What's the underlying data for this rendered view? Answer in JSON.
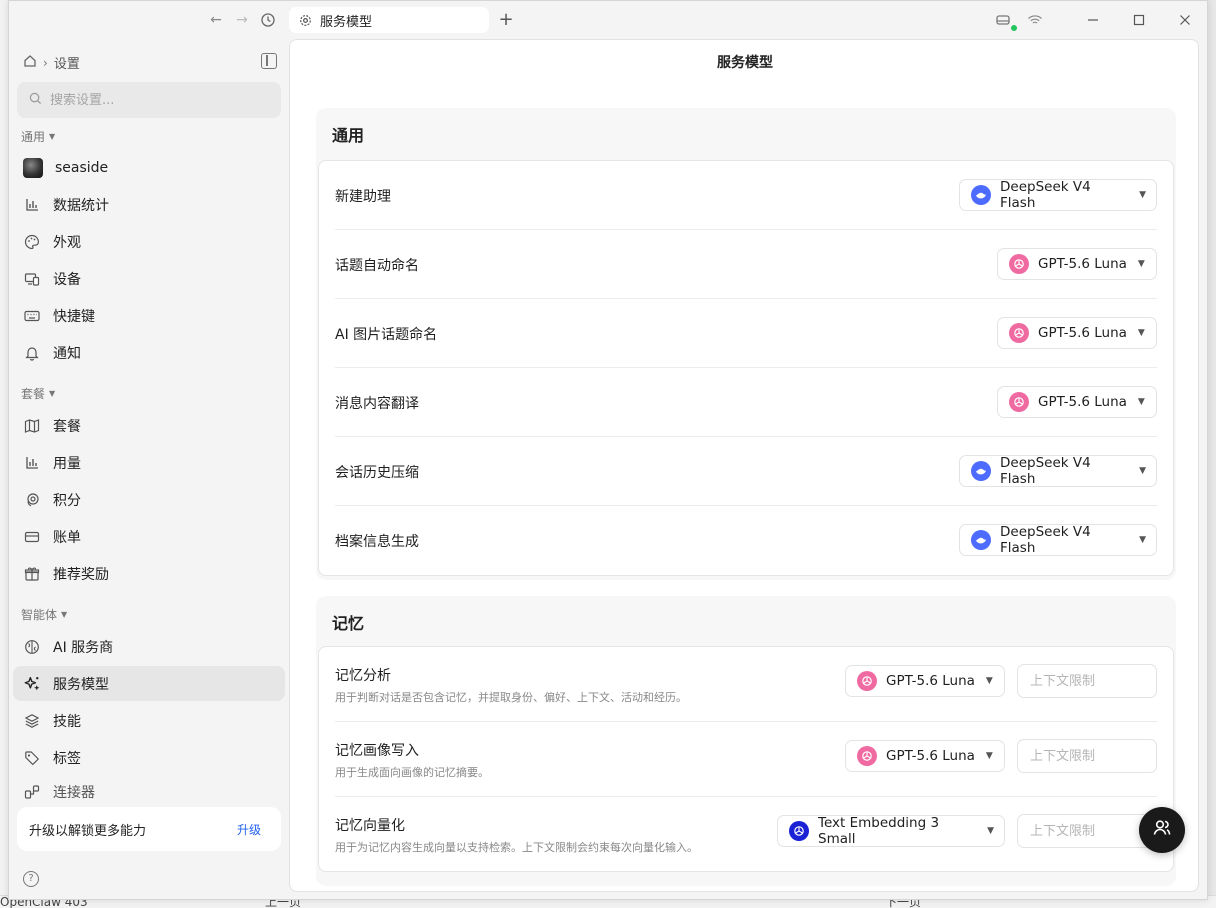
{
  "tab": {
    "title": "服务模型"
  },
  "breadcrumb": {
    "current": "设置"
  },
  "search": {
    "placeholder": "搜索设置..."
  },
  "sidebar": {
    "groups": [
      {
        "label": "通用"
      },
      {
        "label": "套餐"
      },
      {
        "label": "智能体"
      }
    ],
    "items": [
      {
        "label": "seaside",
        "icon": "avatar"
      },
      {
        "label": "数据统计",
        "icon": "bar-chart-icon"
      },
      {
        "label": "外观",
        "icon": "palette-icon"
      },
      {
        "label": "设备",
        "icon": "devices-icon"
      },
      {
        "label": "快捷键",
        "icon": "keyboard-icon"
      },
      {
        "label": "通知",
        "icon": "bell-icon"
      },
      {
        "label": "套餐",
        "icon": "map-icon"
      },
      {
        "label": "用量",
        "icon": "bar-chart-icon"
      },
      {
        "label": "积分",
        "icon": "coin-icon"
      },
      {
        "label": "账单",
        "icon": "card-icon"
      },
      {
        "label": "推荐奖励",
        "icon": "gift-icon"
      },
      {
        "label": "AI 服务商",
        "icon": "brain-icon"
      },
      {
        "label": "服务模型",
        "icon": "sparkles-icon"
      },
      {
        "label": "技能",
        "icon": "layers-icon"
      },
      {
        "label": "标签",
        "icon": "tag-icon"
      },
      {
        "label": "连接器",
        "icon": "plug-icon"
      }
    ],
    "upgrade": {
      "text": "升级以解锁更多能力",
      "link": "升级"
    }
  },
  "main": {
    "title": "服务模型",
    "general": {
      "title": "通用",
      "rows": [
        {
          "label": "新建助理",
          "model": "DeepSeek V4 Flash",
          "provider": "deepseek"
        },
        {
          "label": "话题自动命名",
          "model": "GPT-5.6 Luna",
          "provider": "gpt"
        },
        {
          "label": "AI 图片话题命名",
          "model": "GPT-5.6 Luna",
          "provider": "gpt"
        },
        {
          "label": "消息内容翻译",
          "model": "GPT-5.6 Luna",
          "provider": "gpt"
        },
        {
          "label": "会话历史压缩",
          "model": "DeepSeek V4 Flash",
          "provider": "deepseek"
        },
        {
          "label": "档案信息生成",
          "model": "DeepSeek V4 Flash",
          "provider": "deepseek"
        }
      ]
    },
    "memory": {
      "title": "记忆",
      "rows": [
        {
          "label": "记忆分析",
          "desc": "用于判断对话是否包含记忆，并提取身份、偏好、上下文、活动和经历。",
          "model": "GPT-5.6 Luna",
          "provider": "gpt",
          "limit_placeholder": "上下文限制"
        },
        {
          "label": "记忆画像写入",
          "desc": "用于生成面向画像的记忆摘要。",
          "model": "GPT-5.6 Luna",
          "provider": "gpt",
          "limit_placeholder": "上下文限制"
        },
        {
          "label": "记忆向量化",
          "desc": "用于为记忆内容生成向量以支持检索。上下文限制会约束每次向量化输入。",
          "model": "Text Embedding 3 Small",
          "provider": "embed",
          "limit_placeholder": "上下文限制"
        }
      ]
    }
  },
  "background": {
    "bottom_left": "OpenClaw 403",
    "prev_page": "上一页",
    "next_page": "下一页"
  },
  "colors": {
    "accent": "#2563eb",
    "deepseek": "#4d6bfe",
    "gpt": "#f06aa2",
    "embedding": "#1b22d6",
    "status_online": "#22c55e"
  }
}
